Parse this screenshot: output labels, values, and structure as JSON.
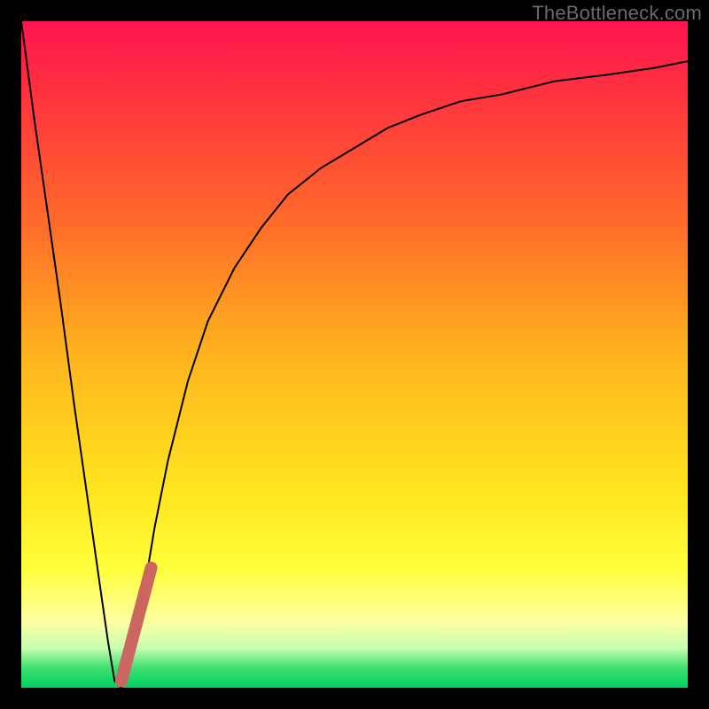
{
  "watermark": "TheBottleneck.com",
  "chart_data": {
    "type": "line",
    "title": "",
    "xlabel": "",
    "ylabel": "",
    "xlim": [
      0,
      100
    ],
    "ylim": [
      0,
      100
    ],
    "grid": false,
    "legend": false,
    "series": [
      {
        "name": "bottleneck-curve",
        "color": "#000000",
        "stroke_width": 2,
        "x": [
          0,
          2,
          4,
          6,
          8,
          10,
          12,
          13,
          14,
          15,
          16,
          18,
          20,
          22,
          25,
          28,
          32,
          36,
          40,
          45,
          50,
          55,
          60,
          66,
          72,
          80,
          88,
          95,
          100
        ],
        "y": [
          100,
          85,
          71,
          57,
          42,
          28,
          14,
          7,
          1,
          0,
          2,
          12,
          24,
          34,
          46,
          55,
          63,
          69,
          74,
          78,
          81,
          84,
          86,
          88,
          89,
          91,
          92,
          93,
          94
        ]
      },
      {
        "name": "highlight-segment",
        "color": "#cc6660",
        "stroke_width": 14,
        "linecap": "round",
        "x": [
          15.0,
          19.5
        ],
        "y": [
          1.0,
          18.0
        ]
      }
    ]
  }
}
